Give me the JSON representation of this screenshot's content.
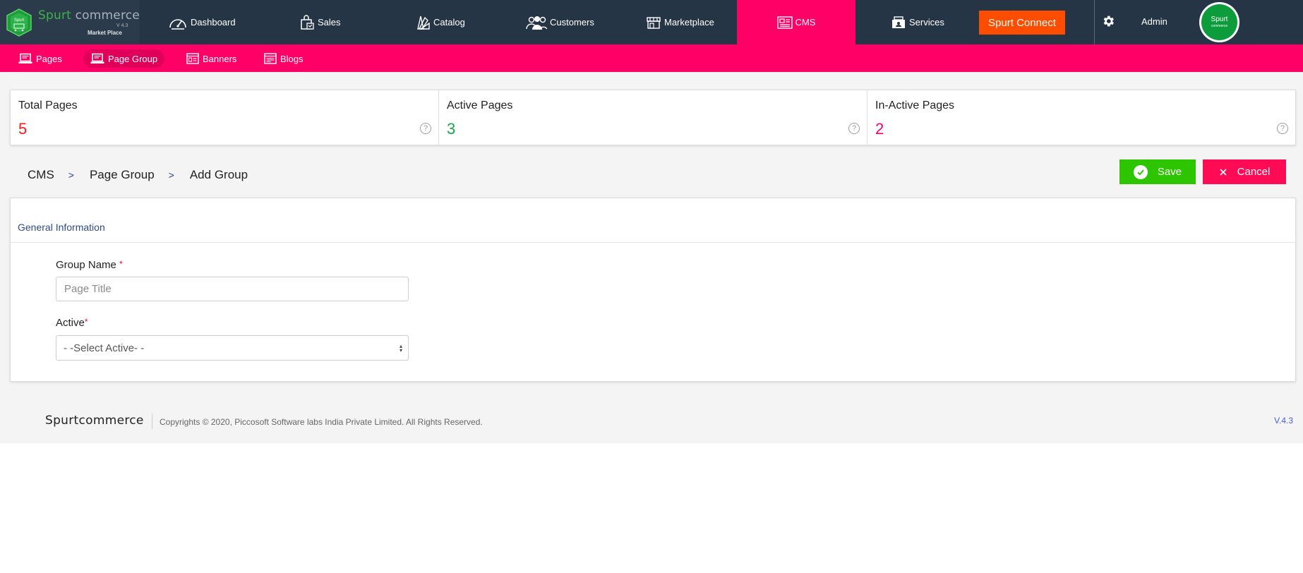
{
  "brand": {
    "logo_word1": "Spurt",
    "logo_word2": " commerce",
    "logo_version": "V 4.3",
    "logo_subtitle": "Market Place",
    "badge_text": "Spurt"
  },
  "nav": {
    "items": [
      {
        "label": "Dashboard",
        "icon": "speedometer-icon"
      },
      {
        "label": "Sales",
        "icon": "shopping-bag-icon"
      },
      {
        "label": "Catalog",
        "icon": "color-swatch-icon"
      },
      {
        "label": "Customers",
        "icon": "users-icon"
      },
      {
        "label": "Marketplace",
        "icon": "store-icon"
      },
      {
        "label": "CMS",
        "icon": "newspaper-icon",
        "active": true
      },
      {
        "label": "Services",
        "icon": "services-icon"
      }
    ],
    "connect_label": "Spurt Connect",
    "admin_label": "Admin",
    "avatar_text": "Spurt",
    "avatar_subtext": "commerce"
  },
  "subnav": {
    "items": [
      {
        "label": "Pages",
        "icon": "laptop-icon"
      },
      {
        "label": "Page Group",
        "icon": "laptop-icon",
        "active": true
      },
      {
        "label": "Banners",
        "icon": "banner-icon"
      },
      {
        "label": "Blogs",
        "icon": "blog-icon"
      }
    ]
  },
  "stats": [
    {
      "label": "Total Pages",
      "value": "5",
      "color": "#ff1a1a"
    },
    {
      "label": "Active Pages",
      "value": "3",
      "color": "#14a84a"
    },
    {
      "label": "In-Active Pages",
      "value": "2",
      "color": "#ff0066"
    }
  ],
  "stat_help_glyph": "?",
  "breadcrumb": {
    "items": [
      "CMS",
      "Page Group",
      "Add Group"
    ],
    "separator": ">"
  },
  "actions": {
    "save_label": "Save",
    "cancel_label": "Cancel"
  },
  "form": {
    "section_title": "General Information",
    "group_name_label": "Group Name",
    "group_name_placeholder": "Page Title",
    "active_label": "Active",
    "active_value": "- -Select Active- -",
    "required_mark": "*"
  },
  "footer": {
    "brand": "Spurtcommerce",
    "copyright": "Copyrights © 2020, Piccosoft Software labs India Private Limited. All Rights Reserved.",
    "version": "V.4.3"
  },
  "colors": {
    "topbar": "#263545",
    "accent_pink": "#ff0066",
    "connect_orange": "#ff4d00",
    "save_green": "#2dc400",
    "cancel_red": "#ff0a54"
  }
}
